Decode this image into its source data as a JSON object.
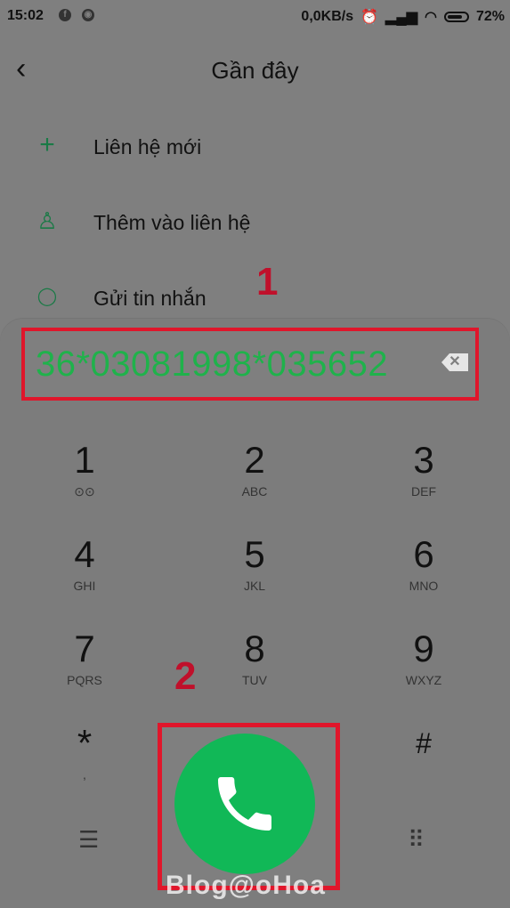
{
  "status": {
    "time": "15:02",
    "app_icons": [
      "f",
      "◉"
    ],
    "net_speed": "0,0KB/s",
    "battery": "72%"
  },
  "header": {
    "title": "Gần đây",
    "back_glyph": "‹"
  },
  "menu": [
    {
      "icon": "plus-icon",
      "glyph": "+",
      "label": "Liên hệ mới"
    },
    {
      "icon": "person-icon",
      "glyph": "♙",
      "label": "Thêm vào liên hệ"
    },
    {
      "icon": "message-icon",
      "glyph": "◯",
      "label": "Gửi tin nhắn"
    }
  ],
  "markers": {
    "one": "1",
    "two": "2"
  },
  "dial_input": {
    "value": "36*03081998*035652"
  },
  "keypad": [
    {
      "digit": "1",
      "letters": "⊙⊙"
    },
    {
      "digit": "2",
      "letters": "ABC"
    },
    {
      "digit": "3",
      "letters": "DEF"
    },
    {
      "digit": "4",
      "letters": "GHI"
    },
    {
      "digit": "5",
      "letters": "JKL"
    },
    {
      "digit": "6",
      "letters": "MNO"
    },
    {
      "digit": "7",
      "letters": "PQRS"
    },
    {
      "digit": "8",
      "letters": "TUV"
    },
    {
      "digit": "9",
      "letters": "WXYZ"
    },
    {
      "digit": "*",
      "letters": ","
    },
    {
      "digit": "#",
      "letters": ""
    }
  ],
  "bottom": {
    "menu_glyph": "☰",
    "keypad_glyph": "⠿"
  },
  "watermark": "Blog@oHoa",
  "colors": {
    "accent": "#11b857",
    "highlight": "#e0162b",
    "number_text": "#1fb24b"
  }
}
